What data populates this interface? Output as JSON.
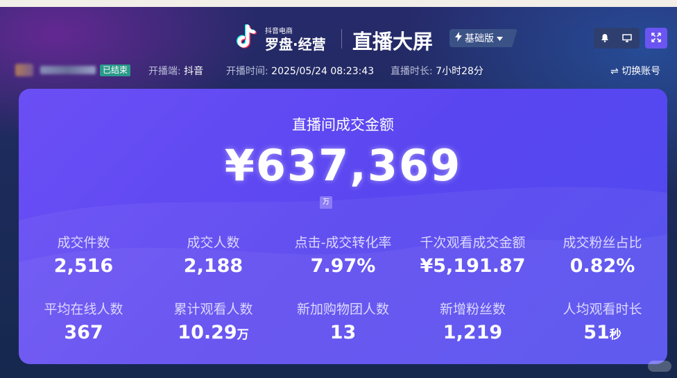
{
  "header": {
    "brand_small": "抖音电商",
    "brand_main": "罗盘·经营",
    "page_title": "直播大屏",
    "edition_label": "基础版"
  },
  "info": {
    "status_badge": "已结束",
    "platform_label": "开播端:",
    "platform_value": "抖音",
    "start_label": "开播时间:",
    "start_value": "2025/05/24 08:23:43",
    "duration_label": "直播时长:",
    "duration_value": "7小时28分",
    "switch_account": "切换账号"
  },
  "main": {
    "gmv_title": "直播间成交金额",
    "gmv_value": "¥637,369",
    "gmv_unit_tag": "万",
    "metrics": [
      {
        "label": "成交件数",
        "value": "2,516",
        "unit": ""
      },
      {
        "label": "成交人数",
        "value": "2,188",
        "unit": ""
      },
      {
        "label": "点击-成交转化率",
        "value": "7.97%",
        "unit": ""
      },
      {
        "label": "千次观看成交金额",
        "value": "¥5,191.87",
        "unit": ""
      },
      {
        "label": "成交粉丝占比",
        "value": "0.82%",
        "unit": ""
      },
      {
        "label": "平均在线人数",
        "value": "367",
        "unit": ""
      },
      {
        "label": "累计观看人数",
        "value": "10.29",
        "unit": "万"
      },
      {
        "label": "新加购物团人数",
        "value": "13",
        "unit": ""
      },
      {
        "label": "新增粉丝数",
        "value": "1,219",
        "unit": ""
      },
      {
        "label": "人均观看时长",
        "value": "51",
        "unit": "秒"
      }
    ]
  },
  "icons": {
    "brand": "tiktok-logo-icon",
    "edition": "lightning-icon",
    "toolbar": [
      "bell-icon",
      "monitor-icon",
      "fullscreen-icon"
    ],
    "switch": "swap-icon"
  },
  "colors": {
    "accent": "#6b55f2",
    "card_start": "#6b4ff5",
    "card_end": "#4f4aef",
    "badge": "#2a9a8a",
    "background": "#1d2b5c"
  }
}
